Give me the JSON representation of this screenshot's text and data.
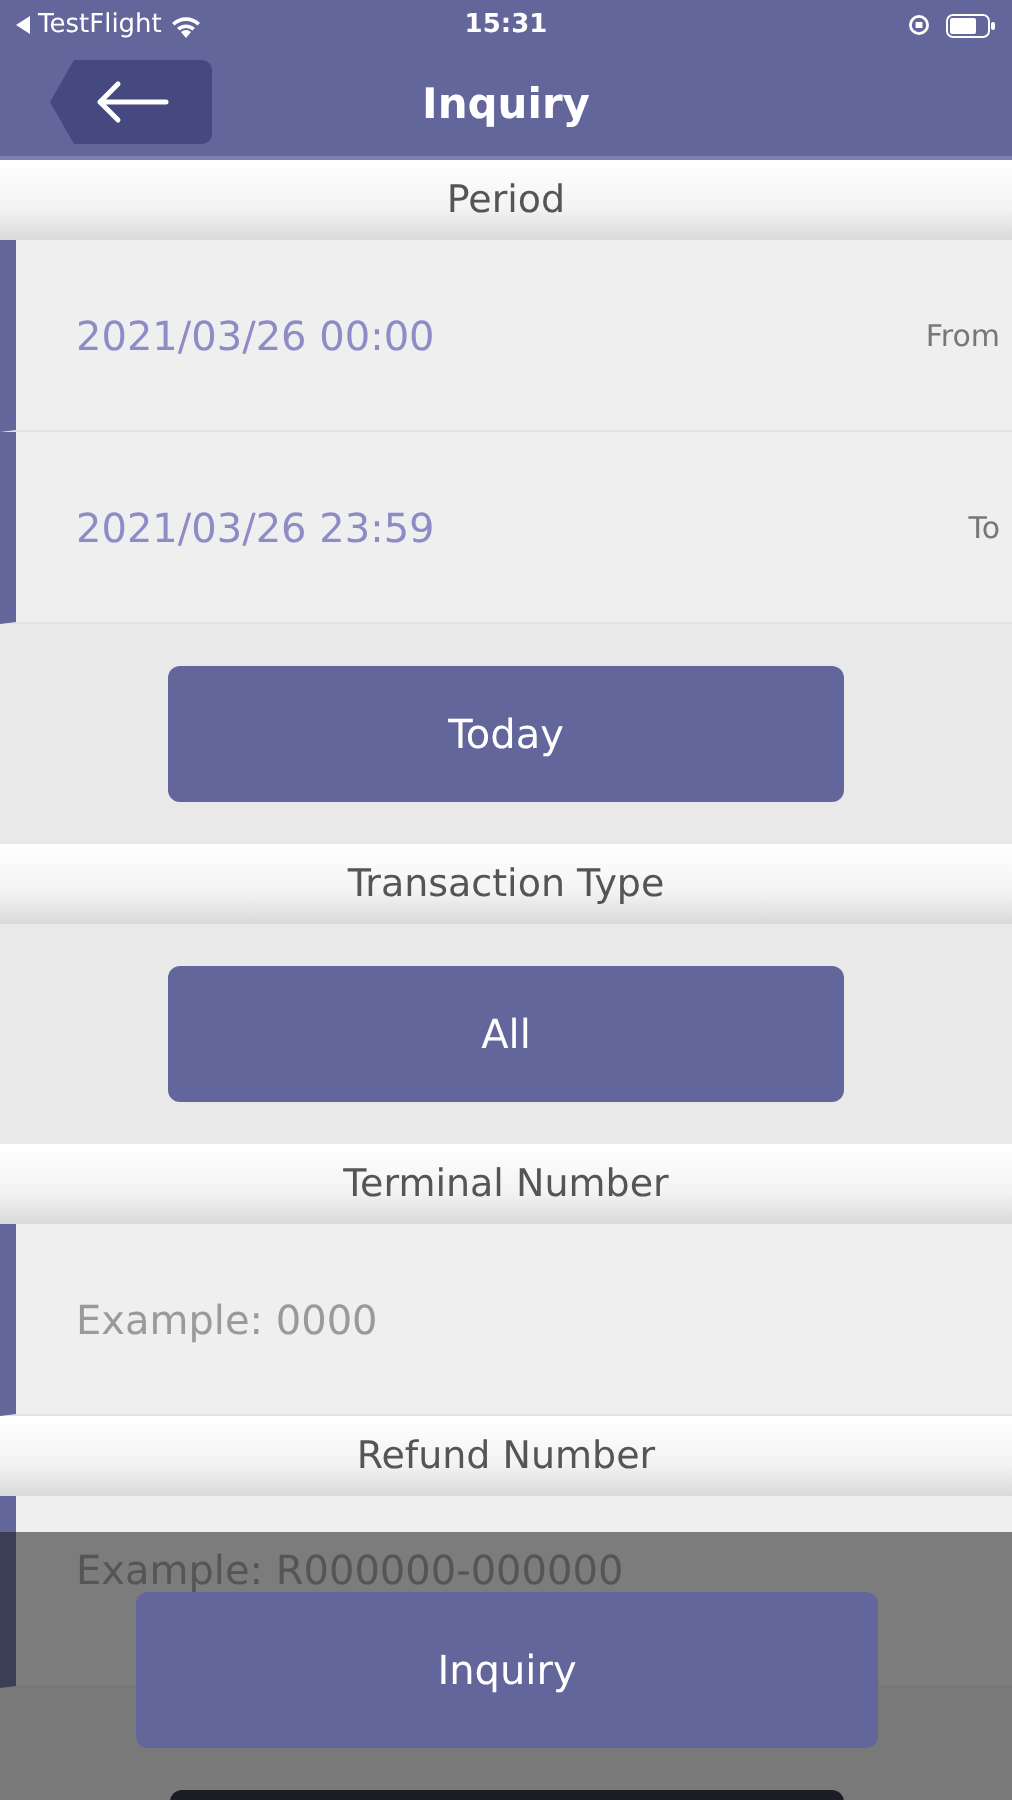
{
  "status_bar": {
    "back_app": "TestFlight",
    "time": "15:31"
  },
  "header": {
    "title": "Inquiry"
  },
  "sections": [
    {
      "title": "Period",
      "items": [
        {
          "kind": "field",
          "value": "2021/03/26 00:00",
          "label": "From"
        },
        {
          "kind": "field",
          "value": "2021/03/26 23:59",
          "label": "To"
        },
        {
          "kind": "button",
          "label": "Today"
        }
      ]
    },
    {
      "title": "Transaction Type",
      "items": [
        {
          "kind": "button",
          "label": "All"
        }
      ]
    },
    {
      "title": "Terminal Number",
      "items": [
        {
          "kind": "field",
          "placeholder": "Example: 0000"
        }
      ]
    },
    {
      "title": "Refund Number",
      "items": [
        {
          "kind": "field",
          "placeholder": "Example: R000000-000000"
        }
      ]
    }
  ],
  "footer": {
    "button": "Inquiry"
  }
}
